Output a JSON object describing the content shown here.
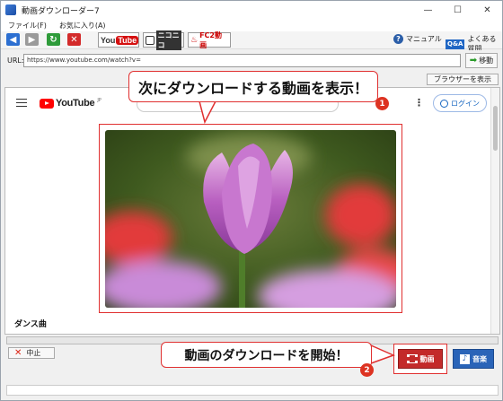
{
  "window": {
    "title": "動画ダウンローダー7",
    "controls": [
      "—",
      "☐",
      "✕"
    ]
  },
  "menu": [
    "ファイル(F)",
    "お気に入り(A)"
  ],
  "toolbar": {
    "youtube_you": "You",
    "youtube_tube": "Tube",
    "nico_label": "ニコニコ",
    "fc2_label": "FC2動画",
    "manual_label": "マニュアル",
    "qa_badge": "Q&A",
    "faq_label": "よくある質問",
    "accent": "#d51010"
  },
  "urlbar": {
    "label": "URL:",
    "value": "https://www.youtube.com/watch?v=",
    "go_label": "移動"
  },
  "browser_button": "ブラウザーを表示",
  "youtube": {
    "logo_text": "YouTube",
    "logo_region": "JP",
    "more_glyph": "⋮",
    "login_label": "ログイン",
    "video_title": "ダンス曲"
  },
  "controls": {
    "stop_label": "中止",
    "download_video_label": "動画",
    "download_music_label": "音楽"
  },
  "callouts": {
    "top_text": "次にダウンロードする動画を表示！",
    "top_badge": "1",
    "bottom_text": "動画のダウンロードを開始！",
    "bottom_badge": "2",
    "color": "#e03030"
  }
}
